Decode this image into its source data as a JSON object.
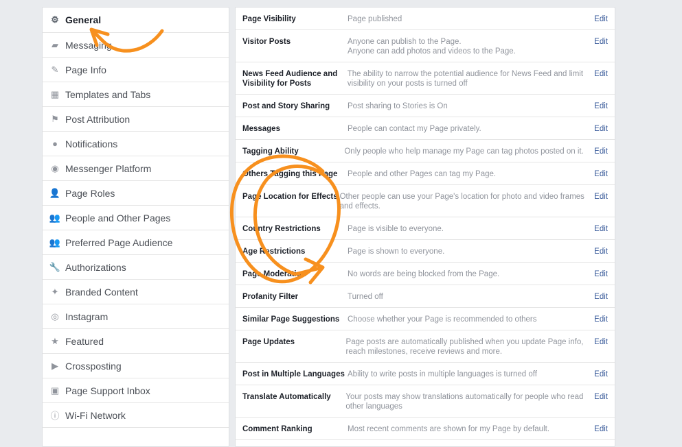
{
  "sidebar": {
    "items": [
      {
        "label": "General",
        "icon": "gear-icon",
        "active": true
      },
      {
        "label": "Messaging",
        "icon": "messaging-icon"
      },
      {
        "label": "Page Info",
        "icon": "pencil-icon"
      },
      {
        "label": "Templates and Tabs",
        "icon": "grid-icon"
      },
      {
        "label": "Post Attribution",
        "icon": "flag-icon"
      },
      {
        "label": "Notifications",
        "icon": "globe-icon"
      },
      {
        "label": "Messenger Platform",
        "icon": "messenger-icon"
      },
      {
        "label": "Page Roles",
        "icon": "person-icon"
      },
      {
        "label": "People and Other Pages",
        "icon": "people-add-icon"
      },
      {
        "label": "Preferred Page Audience",
        "icon": "people-add-icon"
      },
      {
        "label": "Authorizations",
        "icon": "wrench-icon"
      },
      {
        "label": "Branded Content",
        "icon": "handshake-icon"
      },
      {
        "label": "Instagram",
        "icon": "instagram-icon"
      },
      {
        "label": "Featured",
        "icon": "star-icon"
      },
      {
        "label": "Crossposting",
        "icon": "video-camera-icon"
      },
      {
        "label": "Page Support Inbox",
        "icon": "facebook-icon"
      },
      {
        "label": "Wi-Fi Network",
        "icon": "info-icon"
      }
    ]
  },
  "settings": {
    "edit_label": "Edit",
    "rows": [
      {
        "label": "Page Visibility",
        "value": [
          "Page published"
        ]
      },
      {
        "label": "Visitor Posts",
        "value": [
          "Anyone can publish to the Page.",
          "Anyone can add photos and videos to the Page."
        ]
      },
      {
        "label": "News Feed Audience and Visibility for Posts",
        "value": [
          "The ability to narrow the potential audience for News Feed and limit",
          "visibility on your posts is turned off"
        ]
      },
      {
        "label": "Post and Story Sharing",
        "value": [
          "Post sharing to Stories is On"
        ]
      },
      {
        "label": "Messages",
        "value": [
          "People can contact my Page privately."
        ]
      },
      {
        "label": "Tagging Ability",
        "value": [
          "Only people who help manage my Page can tag photos posted on it."
        ]
      },
      {
        "label": "Others Tagging this Page",
        "value": [
          "People and other Pages can tag my Page."
        ]
      },
      {
        "label": "Page Location for Effects",
        "value": [
          "Other people can use your Page's location for photo and video frames",
          "and effects."
        ]
      },
      {
        "label": "Country Restrictions",
        "value": [
          "Page is visible to everyone."
        ]
      },
      {
        "label": "Age Restrictions",
        "value": [
          "Page is shown to everyone."
        ]
      },
      {
        "label": "Page Moderation",
        "value": [
          "No words are being blocked from the Page."
        ]
      },
      {
        "label": "Profanity Filter",
        "value": [
          "Turned off"
        ]
      },
      {
        "label": "Similar Page Suggestions",
        "value": [
          "Choose whether your Page is recommended to others"
        ]
      },
      {
        "label": "Page Updates",
        "value": [
          "Page posts are automatically published when you update Page info,",
          "reach milestones, receive reviews and more."
        ]
      },
      {
        "label": "Post in Multiple Languages",
        "value": [
          "Ability to write posts in multiple languages is turned off"
        ]
      },
      {
        "label": "Translate Automatically",
        "value": [
          "Your posts may show translations automatically for people who read",
          "other languages"
        ]
      },
      {
        "label": "Comment Ranking",
        "value": [
          "Most recent comments are shown for my Page by default."
        ]
      }
    ]
  },
  "annotation_color": "#f7901e"
}
